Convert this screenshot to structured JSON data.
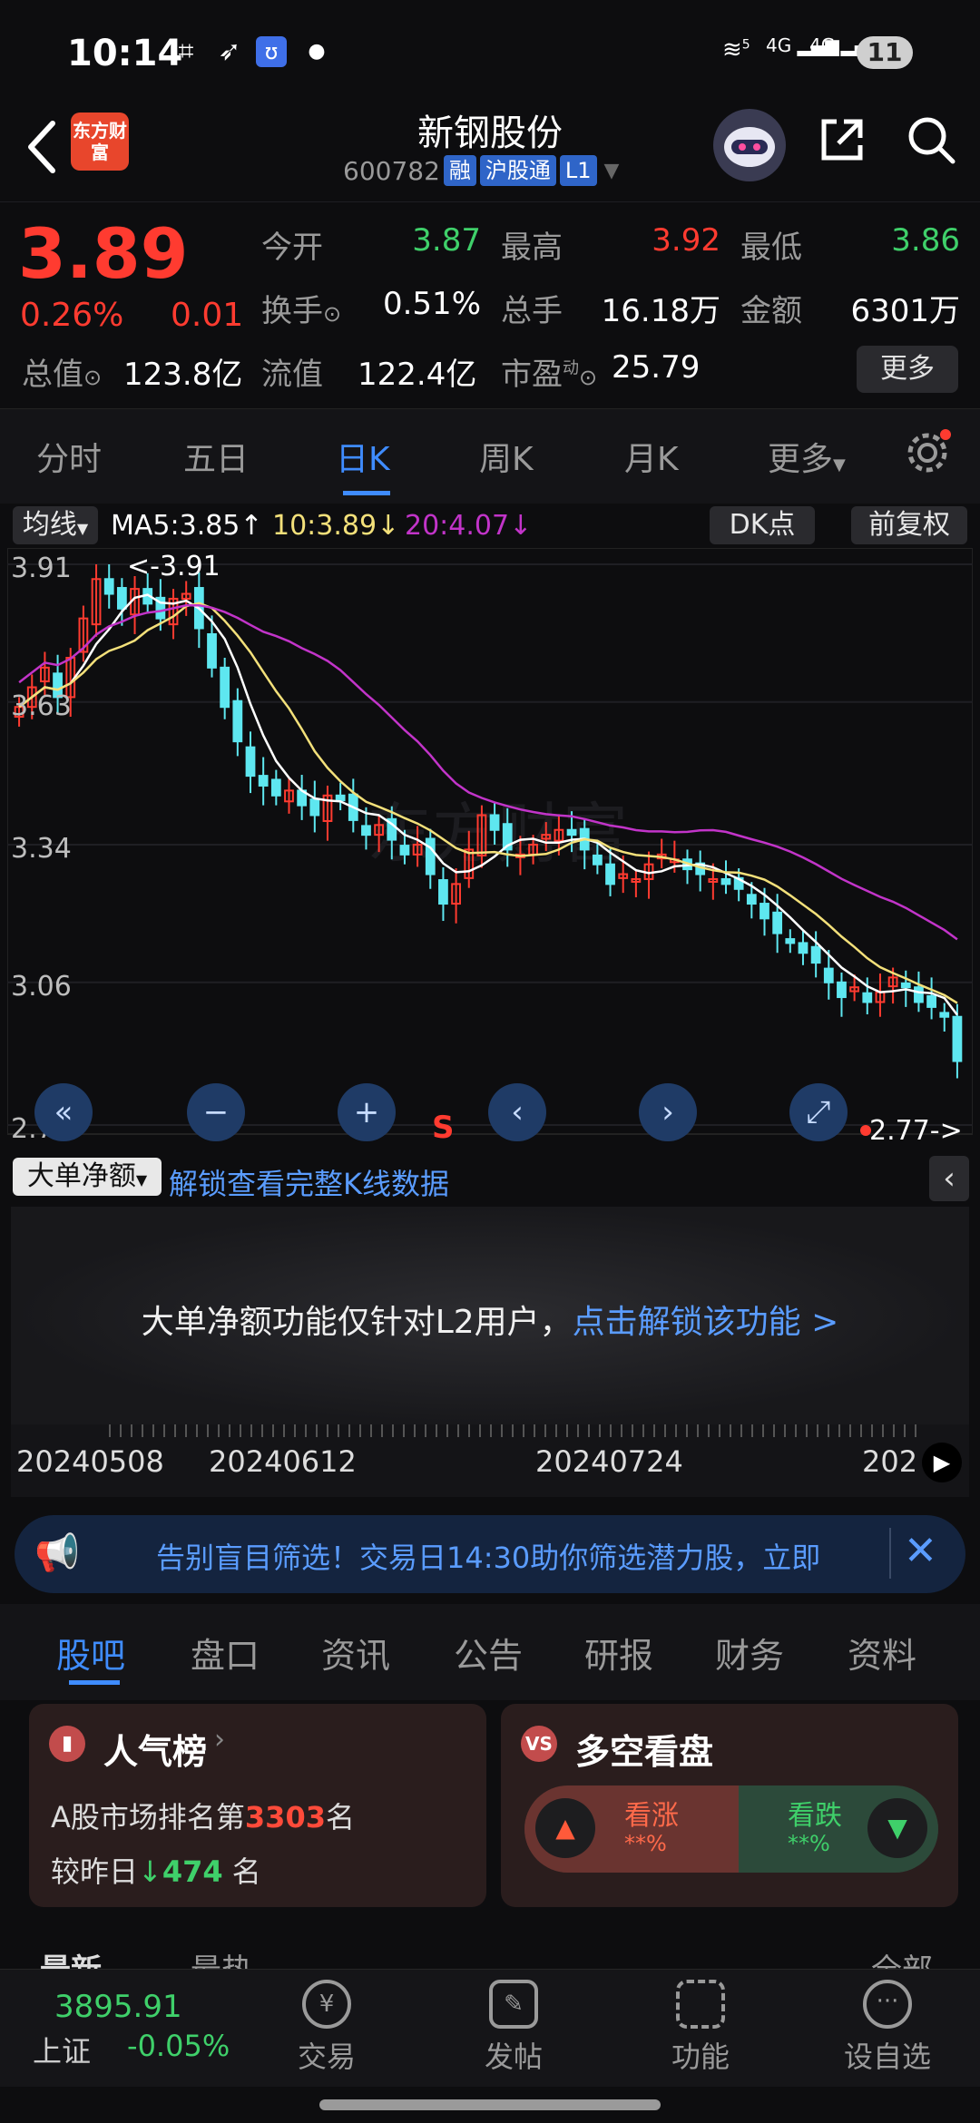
{
  "status_bar": {
    "time": "10:14",
    "battery": "11",
    "net1": "4G",
    "net2": "4G",
    "wifi_badge": "5"
  },
  "header": {
    "stock_name": "新钢股份",
    "code": "600782",
    "tag_rong": "融",
    "tag_hgt": "沪股通",
    "tag_level": "L1",
    "logo_text": "东方财富"
  },
  "quote": {
    "price": "3.89",
    "change_pct": "0.26%",
    "change": "0.01",
    "open_label": "今开",
    "open": "3.87",
    "high_label": "最高",
    "high": "3.92",
    "low_label": "最低",
    "low": "3.86",
    "turnover_label": "换手",
    "turnover": "0.51%",
    "volume_label": "总手",
    "volume": "16.18万",
    "amount_label": "金额",
    "amount": "6301万",
    "mktcap_label": "总值",
    "mktcap": "123.8亿",
    "float_label": "流值",
    "float_cap": "122.4亿",
    "pe_label": "市盈",
    "pe_sup": "动",
    "pe": "25.79",
    "more": "更多"
  },
  "chart_tabs": [
    "分时",
    "五日",
    "日K",
    "周K",
    "月K",
    "更多"
  ],
  "ma_row": {
    "selector": "均线",
    "ma5": "MA5:3.85",
    "ma10": "10:3.89",
    "ma20": "20:4.07",
    "dk": "DK点",
    "adjust": "前复权"
  },
  "chart_data": {
    "type": "candlestick",
    "y_ticks": [
      "3.91",
      "3.63",
      "3.34",
      "3.06",
      "2.77"
    ],
    "ylim": [
      2.77,
      3.91
    ],
    "high_marker": "<-3.91",
    "low_marker": "2.77->",
    "signal": "S",
    "watermark": "东方财富",
    "colors": {
      "up": "#ff3b30",
      "down": "#5ee7f0",
      "ma5": "#ffffff",
      "ma10": "#f3e07a",
      "ma20": "#c234c9"
    },
    "closes": [
      3.62,
      3.66,
      3.7,
      3.64,
      3.72,
      3.8,
      3.88,
      3.85,
      3.82,
      3.86,
      3.83,
      3.8,
      3.84,
      3.85,
      3.78,
      3.7,
      3.62,
      3.55,
      3.48,
      3.46,
      3.44,
      3.45,
      3.42,
      3.4,
      3.44,
      3.43,
      3.39,
      3.36,
      3.38,
      3.35,
      3.32,
      3.34,
      3.28,
      3.22,
      3.26,
      3.33,
      3.4,
      3.37,
      3.33,
      3.32,
      3.34,
      3.36,
      3.37,
      3.36,
      3.33,
      3.3,
      3.26,
      3.28,
      3.27,
      3.3,
      3.32,
      3.31,
      3.29,
      3.28,
      3.27,
      3.26,
      3.25,
      3.22,
      3.19,
      3.16,
      3.14,
      3.12,
      3.1,
      3.06,
      3.03,
      3.05,
      3.02,
      3.04,
      3.07,
      3.05,
      3.02,
      3.01,
      2.99,
      2.9
    ]
  },
  "big_order": {
    "selector": "大单净额",
    "unlock_link": "解锁查看完整K线数据",
    "message": "大单净额功能仅针对L2用户，",
    "message_link": "点击解锁该功能 >"
  },
  "date_axis": [
    "20240508",
    "20240612",
    "20240724",
    "202"
  ],
  "banner": {
    "text": "告别盲目筛选！交易日14:30助你筛选潜力股，立即"
  },
  "lower_tabs": [
    "股吧",
    "盘口",
    "资讯",
    "公告",
    "研报",
    "财务",
    "资料"
  ],
  "popularity": {
    "title": "人气榜",
    "rank_prefix": "A股市场排名第",
    "rank": "3303",
    "rank_suffix": "名",
    "change_prefix": "较昨日",
    "change": "474",
    "change_suffix": "名"
  },
  "bull_bear": {
    "title": "多空看盘",
    "bull": "看涨",
    "bear": "看跌",
    "bull_pct": "**%",
    "bear_pct": "**%"
  },
  "peek": {
    "left": "最新",
    "mid": "最热",
    "right": "全部"
  },
  "bottom_nav": {
    "index_value": "3895.91",
    "index_name": "上证",
    "index_change": "-0.05%",
    "trade": "交易",
    "post": "发帖",
    "functions": "功能",
    "watchlist": "设自选"
  }
}
